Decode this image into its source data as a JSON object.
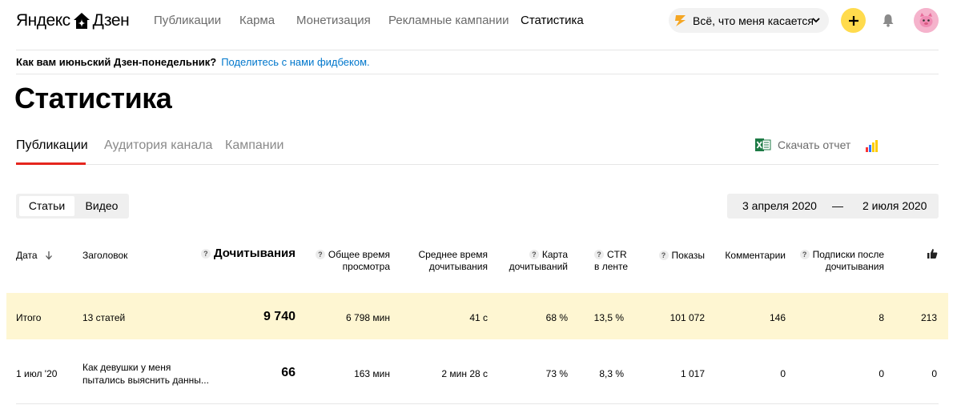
{
  "header": {
    "logo_text": "Яндекс Дзен",
    "logo_part1": "Яндекс",
    "logo_part2": "Дзен",
    "nav": [
      "Публикации",
      "Карма",
      "Монетизация",
      "Рекламные кампании",
      "Статистика"
    ],
    "active_nav": "Статистика",
    "channel_selector": "Всё, что меня касается",
    "accent_color": "#ffdb4d"
  },
  "banner": {
    "question": "Как вам июньский Дзен-понедельник?",
    "link": "Поделитесь с нами фидбеком."
  },
  "page_title": "Статистика",
  "tabs": [
    "Публикации",
    "Аудитория канала",
    "Кампании"
  ],
  "active_tab": "Публикации",
  "download_label": "Скачать отчет",
  "content_type": {
    "options": [
      "Статьи",
      "Видео"
    ],
    "selected": "Статьи"
  },
  "date_range": {
    "from": "3 апреля 2020",
    "separator": "—",
    "to": "2 июля 2020"
  },
  "table": {
    "headers": {
      "date": "Дата",
      "title": "Заголовок",
      "reads": "Дочитывания",
      "total_time_1": "Общее время",
      "total_time_2": "просмотра",
      "avg_time_1": "Среднее время",
      "avg_time_2": "дочитывания",
      "read_map_1": "Карта",
      "read_map_2": "дочитываний",
      "ctr_1": "CTR",
      "ctr_2": "в ленте",
      "views": "Показы",
      "comments": "Комментарии",
      "subs_1": "Подписки после",
      "subs_2": "дочитывания"
    },
    "total": {
      "label": "Итого",
      "title": "13 статей",
      "reads": "9 740",
      "total_time": "6 798 мин",
      "avg_time": "41 с",
      "read_map": "68 %",
      "ctr": "13,5 %",
      "views": "101 072",
      "comments": "146",
      "subs": "8",
      "likes": "213"
    },
    "rows": [
      {
        "date": "1 июл '20",
        "title_1": "Как девушки у меня",
        "title_2": "пытались выяснить данны...",
        "reads": "66",
        "total_time": "163 мин",
        "avg_time": "2 мин 28 с",
        "read_map": "73 %",
        "ctr": "8,3 %",
        "views": "1 017",
        "comments": "0",
        "subs": "0",
        "likes": "0"
      }
    ]
  }
}
